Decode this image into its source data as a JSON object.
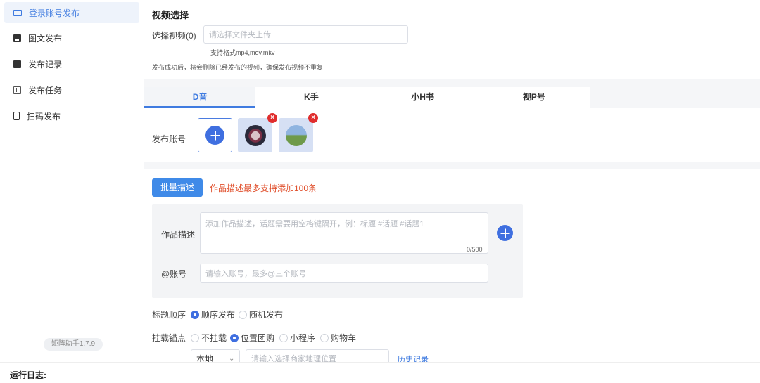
{
  "sidebar": {
    "items": [
      {
        "label": "登录账号发布",
        "icon": "window-icon",
        "active": true
      },
      {
        "label": "图文发布",
        "icon": "image-icon"
      },
      {
        "label": "发布记录",
        "icon": "document-icon"
      },
      {
        "label": "发布任务",
        "icon": "task-icon"
      },
      {
        "label": "扫码发布",
        "icon": "phone-icon"
      }
    ],
    "version": "矩阵助手1.7.9"
  },
  "video": {
    "title": "视频选择",
    "select_label": "选择视频(0)",
    "placeholder": "请选择文件夹上传",
    "formats": "支持格式mp4,mov,mkv",
    "note": "发布成功后，将会删除已经发布的视频，确保发布视频不重复"
  },
  "tabs": [
    "D音",
    "K手",
    "小H书",
    "视P号"
  ],
  "accounts": {
    "label": "发布账号",
    "delete_symbol": "×"
  },
  "desc": {
    "batch_button": "批量描述",
    "warning": "作品描述最多支持添加100条",
    "label": "作品描述",
    "placeholder": "添加作品描述，话题需要用空格键隔开，例：标题 #话题 #话题1",
    "counter": "0/500",
    "at_label": "@账号",
    "at_placeholder": "请输入账号，最多@三个账号"
  },
  "title_order": {
    "label": "标题顺序",
    "options": [
      "顺序发布",
      "随机发布"
    ],
    "selected": "顺序发布"
  },
  "anchor": {
    "label": "挂载锚点",
    "options": [
      "不挂载",
      "位置团购",
      "小程序",
      "购物车"
    ],
    "selected": "位置团购",
    "select_value": "本地",
    "location_placeholder": "请输入选择商家地理位置",
    "history_link": "历史记录"
  },
  "log": {
    "title": "运行日志:"
  },
  "colors": {
    "accent": "#3f7be0",
    "danger": "#e02d2d",
    "warning": "#e0502d"
  }
}
